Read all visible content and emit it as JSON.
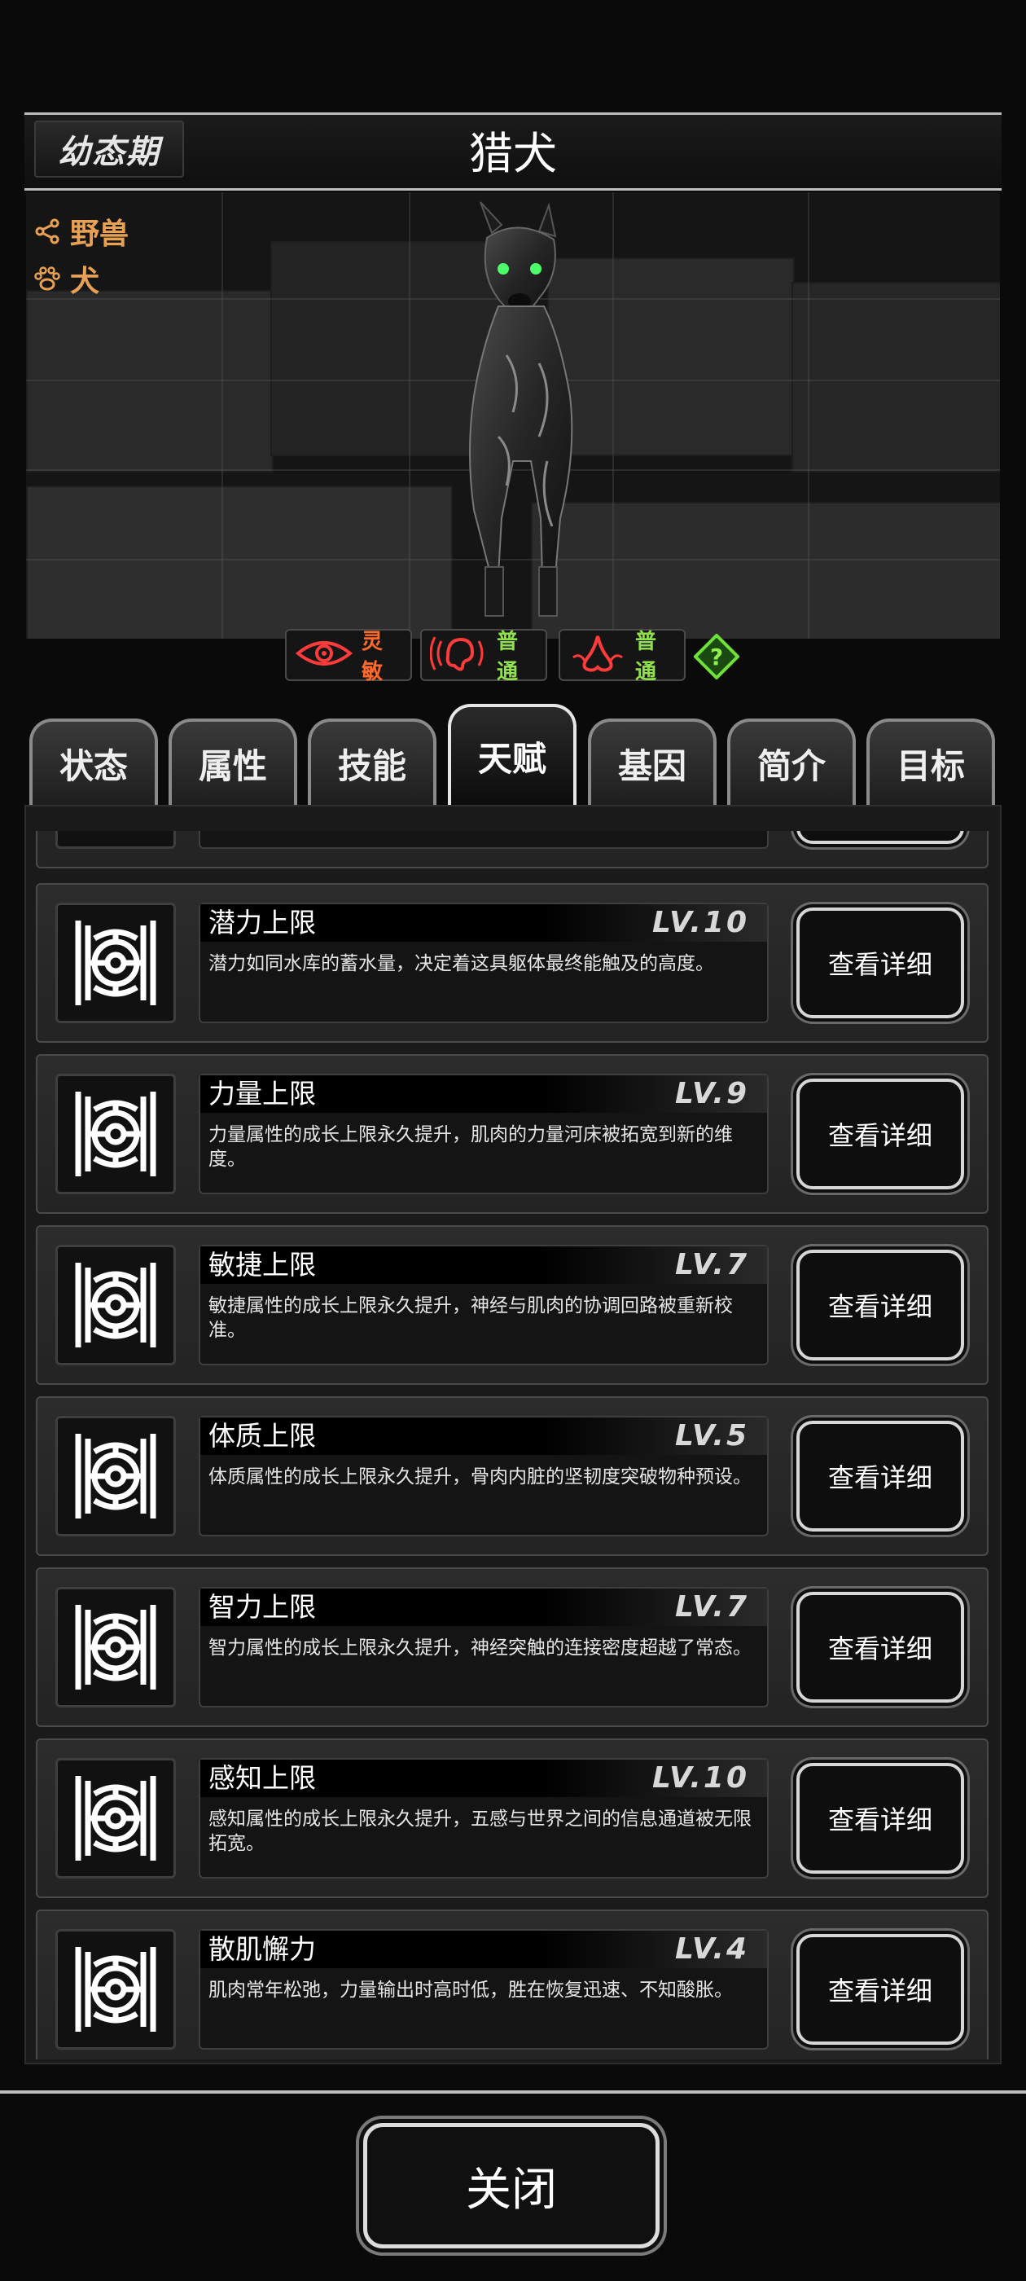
{
  "header": {
    "stage": "幼态期",
    "name": "猎犬"
  },
  "tags": [
    {
      "icon": "share-icon",
      "label": "野兽"
    },
    {
      "icon": "paw-icon",
      "label": "犬"
    }
  ],
  "senses": [
    {
      "icon": "eye-icon",
      "label": "灵敏",
      "color": "#ff6a2a"
    },
    {
      "icon": "ear-icon",
      "label": "普通",
      "color": "#8fe04a"
    },
    {
      "icon": "nose-icon",
      "label": "普通",
      "color": "#8fe04a"
    }
  ],
  "help_icon": "question-icon",
  "tabs": [
    {
      "label": "状态",
      "active": false
    },
    {
      "label": "属性",
      "active": false
    },
    {
      "label": "技能",
      "active": false
    },
    {
      "label": "天赋",
      "active": true
    },
    {
      "label": "基因",
      "active": false
    },
    {
      "label": "简介",
      "active": false
    },
    {
      "label": "目标",
      "active": false
    }
  ],
  "talents": [
    {
      "name": "潜力上限",
      "level": "LV.10",
      "desc": "潜力如同水库的蓄水量，决定着这具躯体最终能触及的高度。",
      "button": "查看详细"
    },
    {
      "name": "力量上限",
      "level": "LV.9",
      "desc": "力量属性的成长上限永久提升，肌肉的力量河床被拓宽到新的维度。",
      "button": "查看详细"
    },
    {
      "name": "敏捷上限",
      "level": "LV.7",
      "desc": "敏捷属性的成长上限永久提升，神经与肌肉的协调回路被重新校准。",
      "button": "查看详细"
    },
    {
      "name": "体质上限",
      "level": "LV.5",
      "desc": "体质属性的成长上限永久提升，骨肉内脏的坚韧度突破物种预设。",
      "button": "查看详细"
    },
    {
      "name": "智力上限",
      "level": "LV.7",
      "desc": "智力属性的成长上限永久提升，神经突触的连接密度超越了常态。",
      "button": "查看详细"
    },
    {
      "name": "感知上限",
      "level": "LV.10",
      "desc": "感知属性的成长上限永久提升，五感与世界之间的信息通道被无限拓宽。",
      "button": "查看详细"
    },
    {
      "name": "散肌懈力",
      "level": "LV.4",
      "desc": "肌肉常年松弛，力量输出时高时低，胜在恢复迅速、不知酸胀。",
      "button": "查看详细"
    }
  ],
  "close_button": "关闭"
}
